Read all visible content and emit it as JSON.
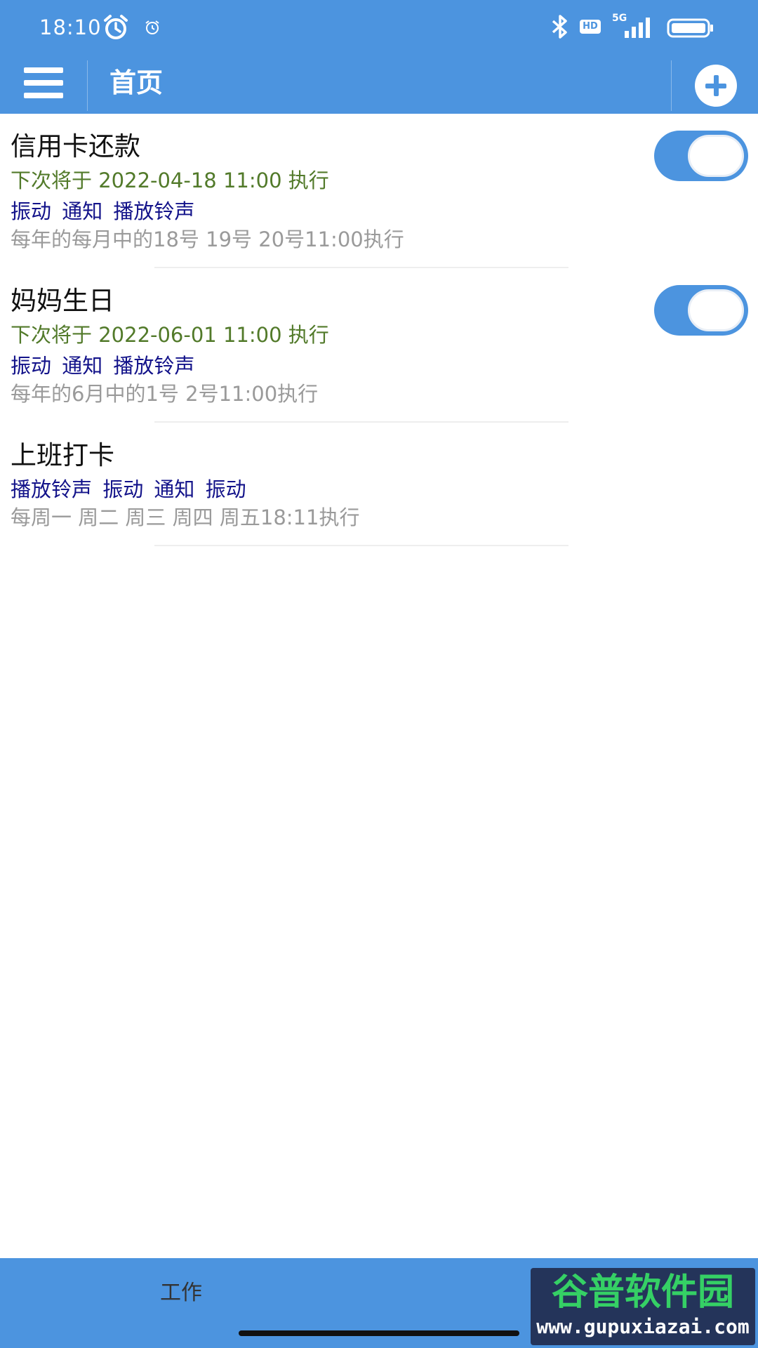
{
  "status_bar": {
    "time": "18:10",
    "network": "5G",
    "hd_badge": "HD",
    "icons": [
      "alarm-icon",
      "alarm-small-icon",
      "bluetooth-icon",
      "hd-icon",
      "signal-icon",
      "battery-icon"
    ]
  },
  "app_bar": {
    "title": "首页",
    "icons": [
      "menu-icon",
      "add-icon"
    ]
  },
  "colors": {
    "primary": "#4c94df",
    "next_time_text": "#527a2a",
    "tags_text": "#13138a",
    "rule_text": "#9a9a9a"
  },
  "alarms": [
    {
      "name": "信用卡还款",
      "next_run": "下次将于 2022-04-18 11:00 执行",
      "tags": "振动  通知  播放铃声",
      "rule": "每年的每月中的18号 19号 20号11:00执行",
      "enabled": true
    },
    {
      "name": "妈妈生日",
      "next_run": "下次将于 2022-06-01 11:00 执行",
      "tags": "振动  通知  播放铃声",
      "rule": "每年的6月中的1号 2号11:00执行",
      "enabled": true
    },
    {
      "name": "上班打卡",
      "tags": "播放铃声  振动  通知  振动",
      "rule": "每周一 周二 周三 周四 周五18:11执行"
    }
  ],
  "bottom_nav": {
    "tab_label": "工作"
  },
  "watermark": {
    "title": "谷普软件园",
    "url": "www.gupuxiazai.com"
  }
}
